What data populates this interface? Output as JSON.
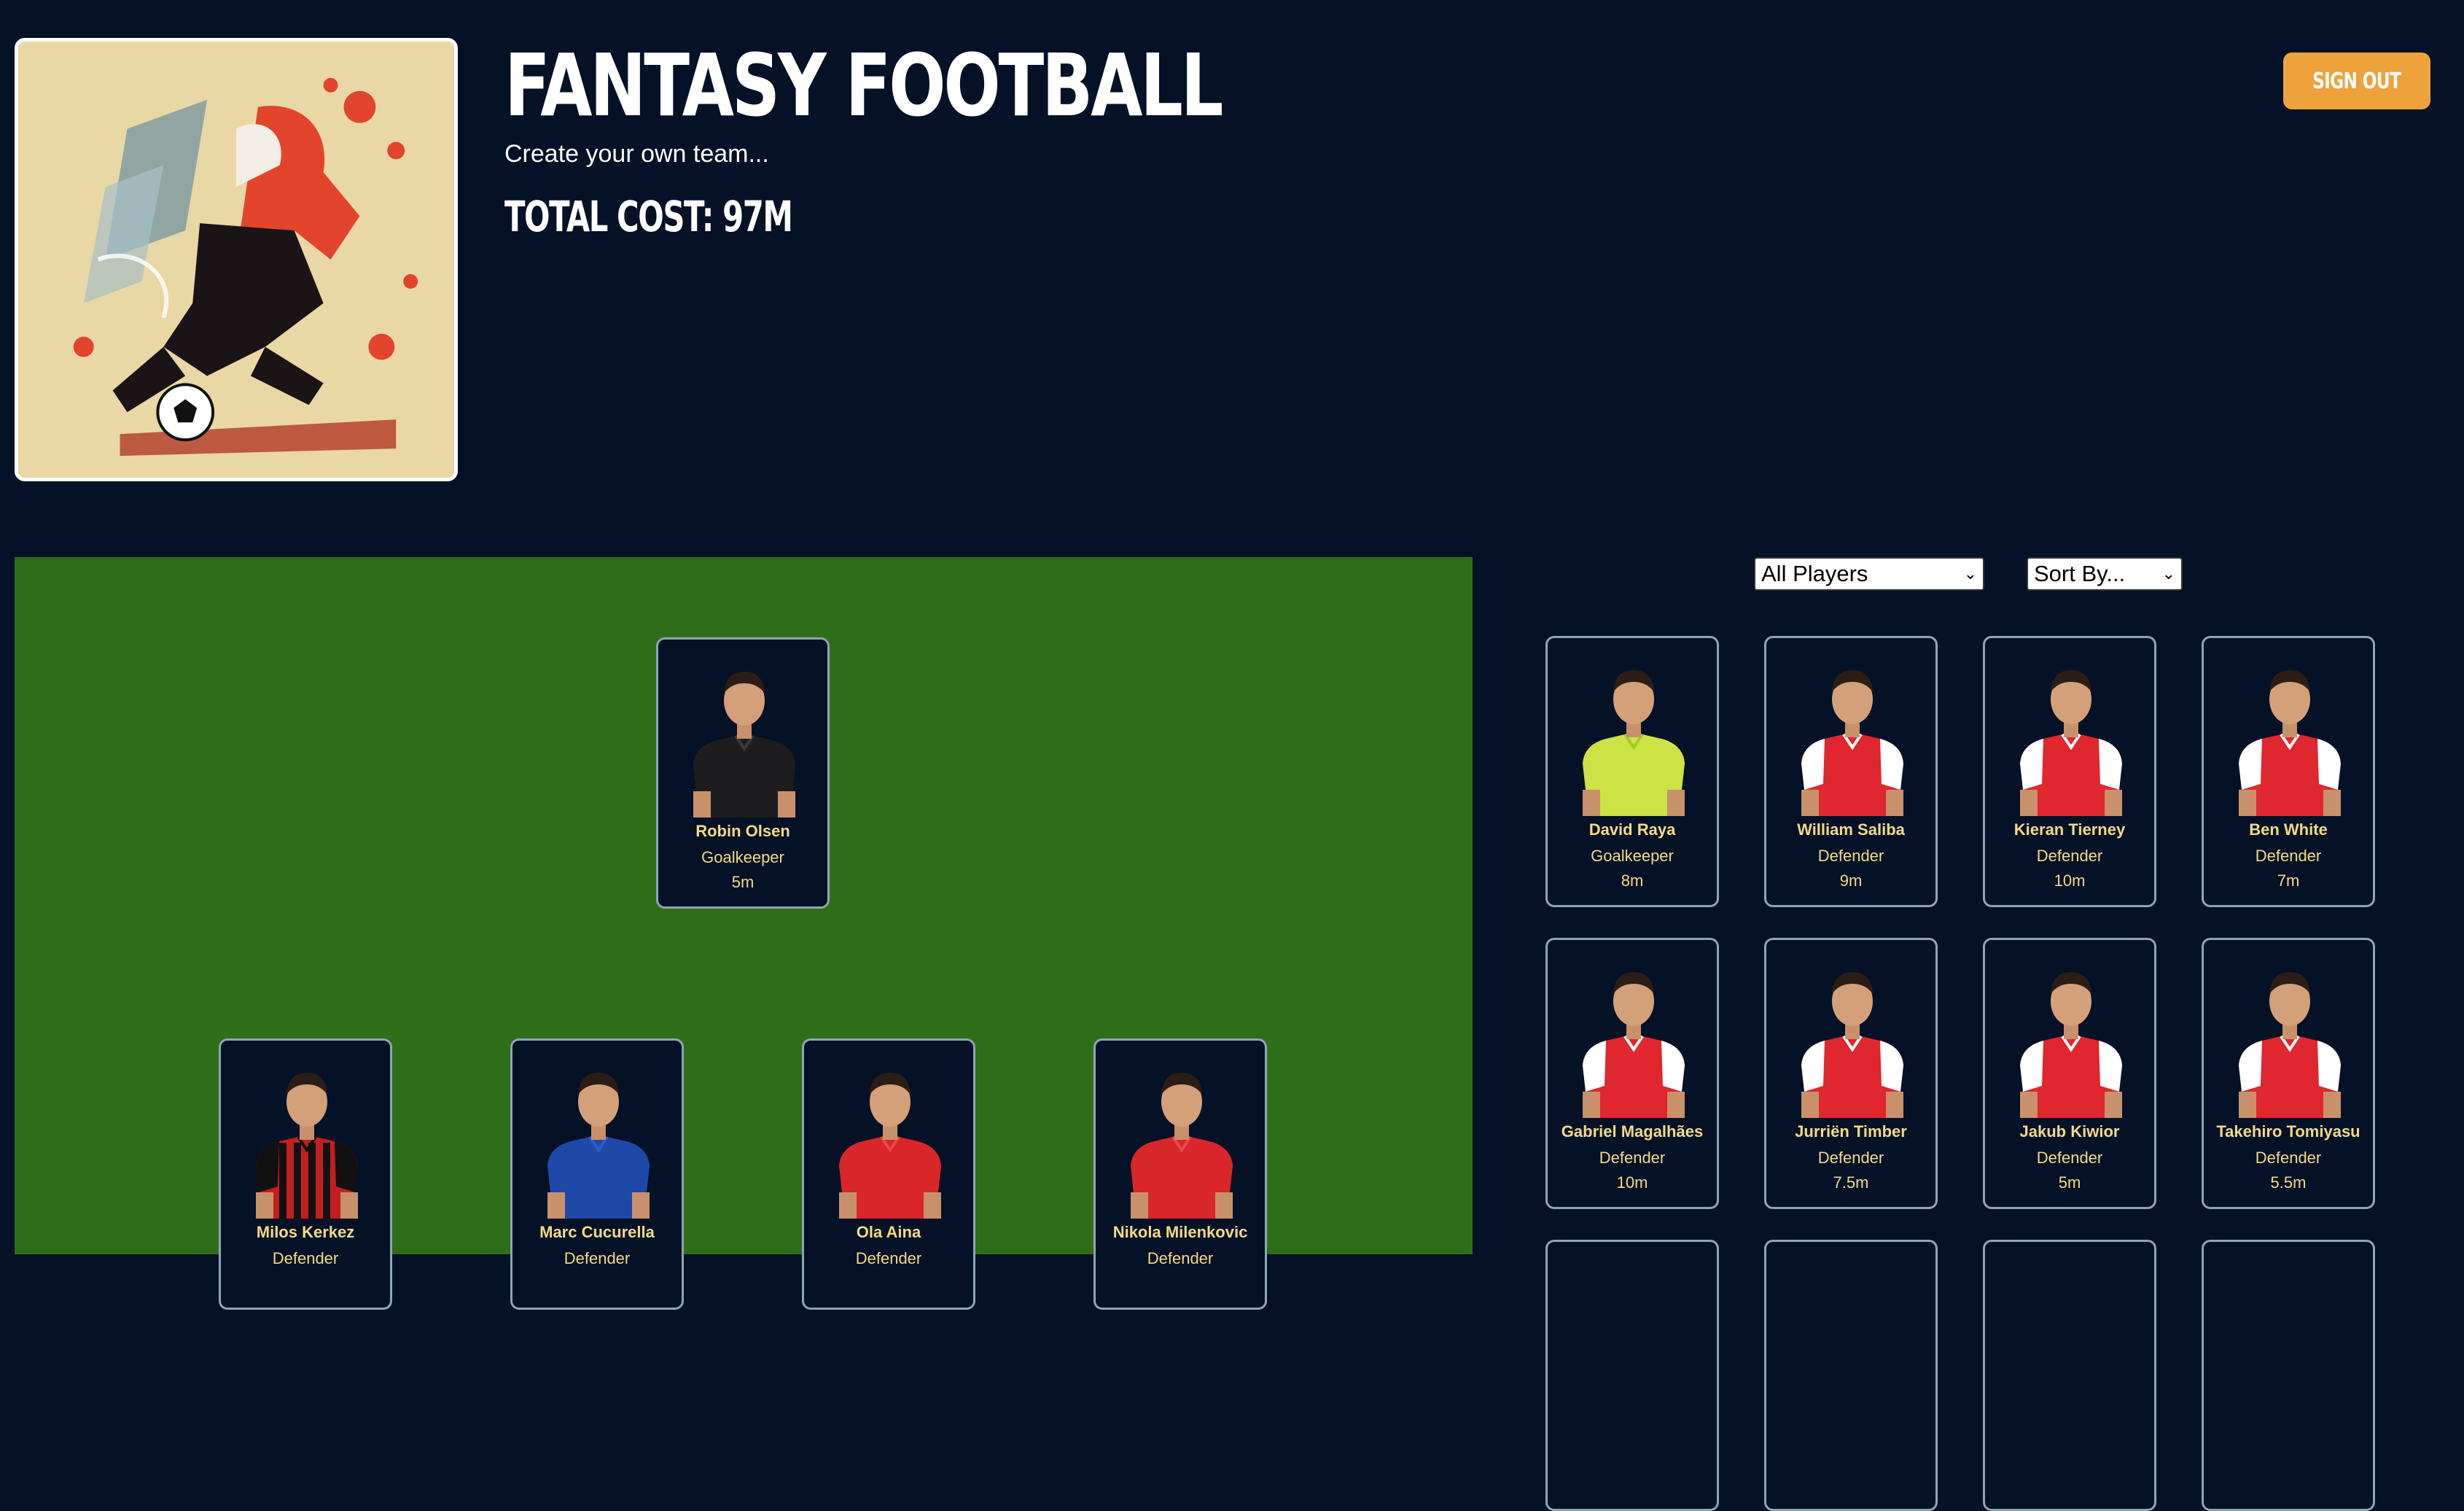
{
  "header": {
    "title": "FANTASY FOOTBALL",
    "subtitle": "Create your own team...",
    "total_cost": "TOTAL COST: 97M",
    "sign_out_label": "SIGN OUT"
  },
  "filters": {
    "player_filter": "All Players",
    "sort": "Sort By..."
  },
  "colors": {
    "background": "#051126",
    "pitch": "#2f6e19",
    "accent": "#eea23c",
    "card_text": "#f3da83",
    "card_border": "#8fa5b5"
  },
  "team": [
    {
      "name": "Robin Olsen",
      "position": "Goalkeeper",
      "cost": "5m",
      "kit": "black"
    },
    {
      "name": "Milos Kerkez",
      "position": "Defender",
      "cost": "",
      "kit": "striped"
    },
    {
      "name": "Marc Cucurella",
      "position": "Defender",
      "cost": "",
      "kit": "blue"
    },
    {
      "name": "Ola Aina",
      "position": "Defender",
      "cost": "",
      "kit": "red"
    },
    {
      "name": "Nikola Milenkovic",
      "position": "Defender",
      "cost": "",
      "kit": "red"
    }
  ],
  "available_players": [
    {
      "name": "David Raya",
      "position": "Goalkeeper",
      "cost": "8m",
      "kit": "yellow"
    },
    {
      "name": "William Saliba",
      "position": "Defender",
      "cost": "9m",
      "kit": "arsenal"
    },
    {
      "name": "Kieran Tierney",
      "position": "Defender",
      "cost": "10m",
      "kit": "arsenal"
    },
    {
      "name": "Ben White",
      "position": "Defender",
      "cost": "7m",
      "kit": "arsenal"
    },
    {
      "name": "Gabriel Magalhães",
      "position": "Defender",
      "cost": "10m",
      "kit": "arsenal"
    },
    {
      "name": "Jurriën Timber",
      "position": "Defender",
      "cost": "7.5m",
      "kit": "arsenal"
    },
    {
      "name": "Jakub Kiwior",
      "position": "Defender",
      "cost": "5m",
      "kit": "arsenal"
    },
    {
      "name": "Takehiro Tomiyasu",
      "position": "Defender",
      "cost": "5.5m",
      "kit": "arsenal"
    }
  ]
}
